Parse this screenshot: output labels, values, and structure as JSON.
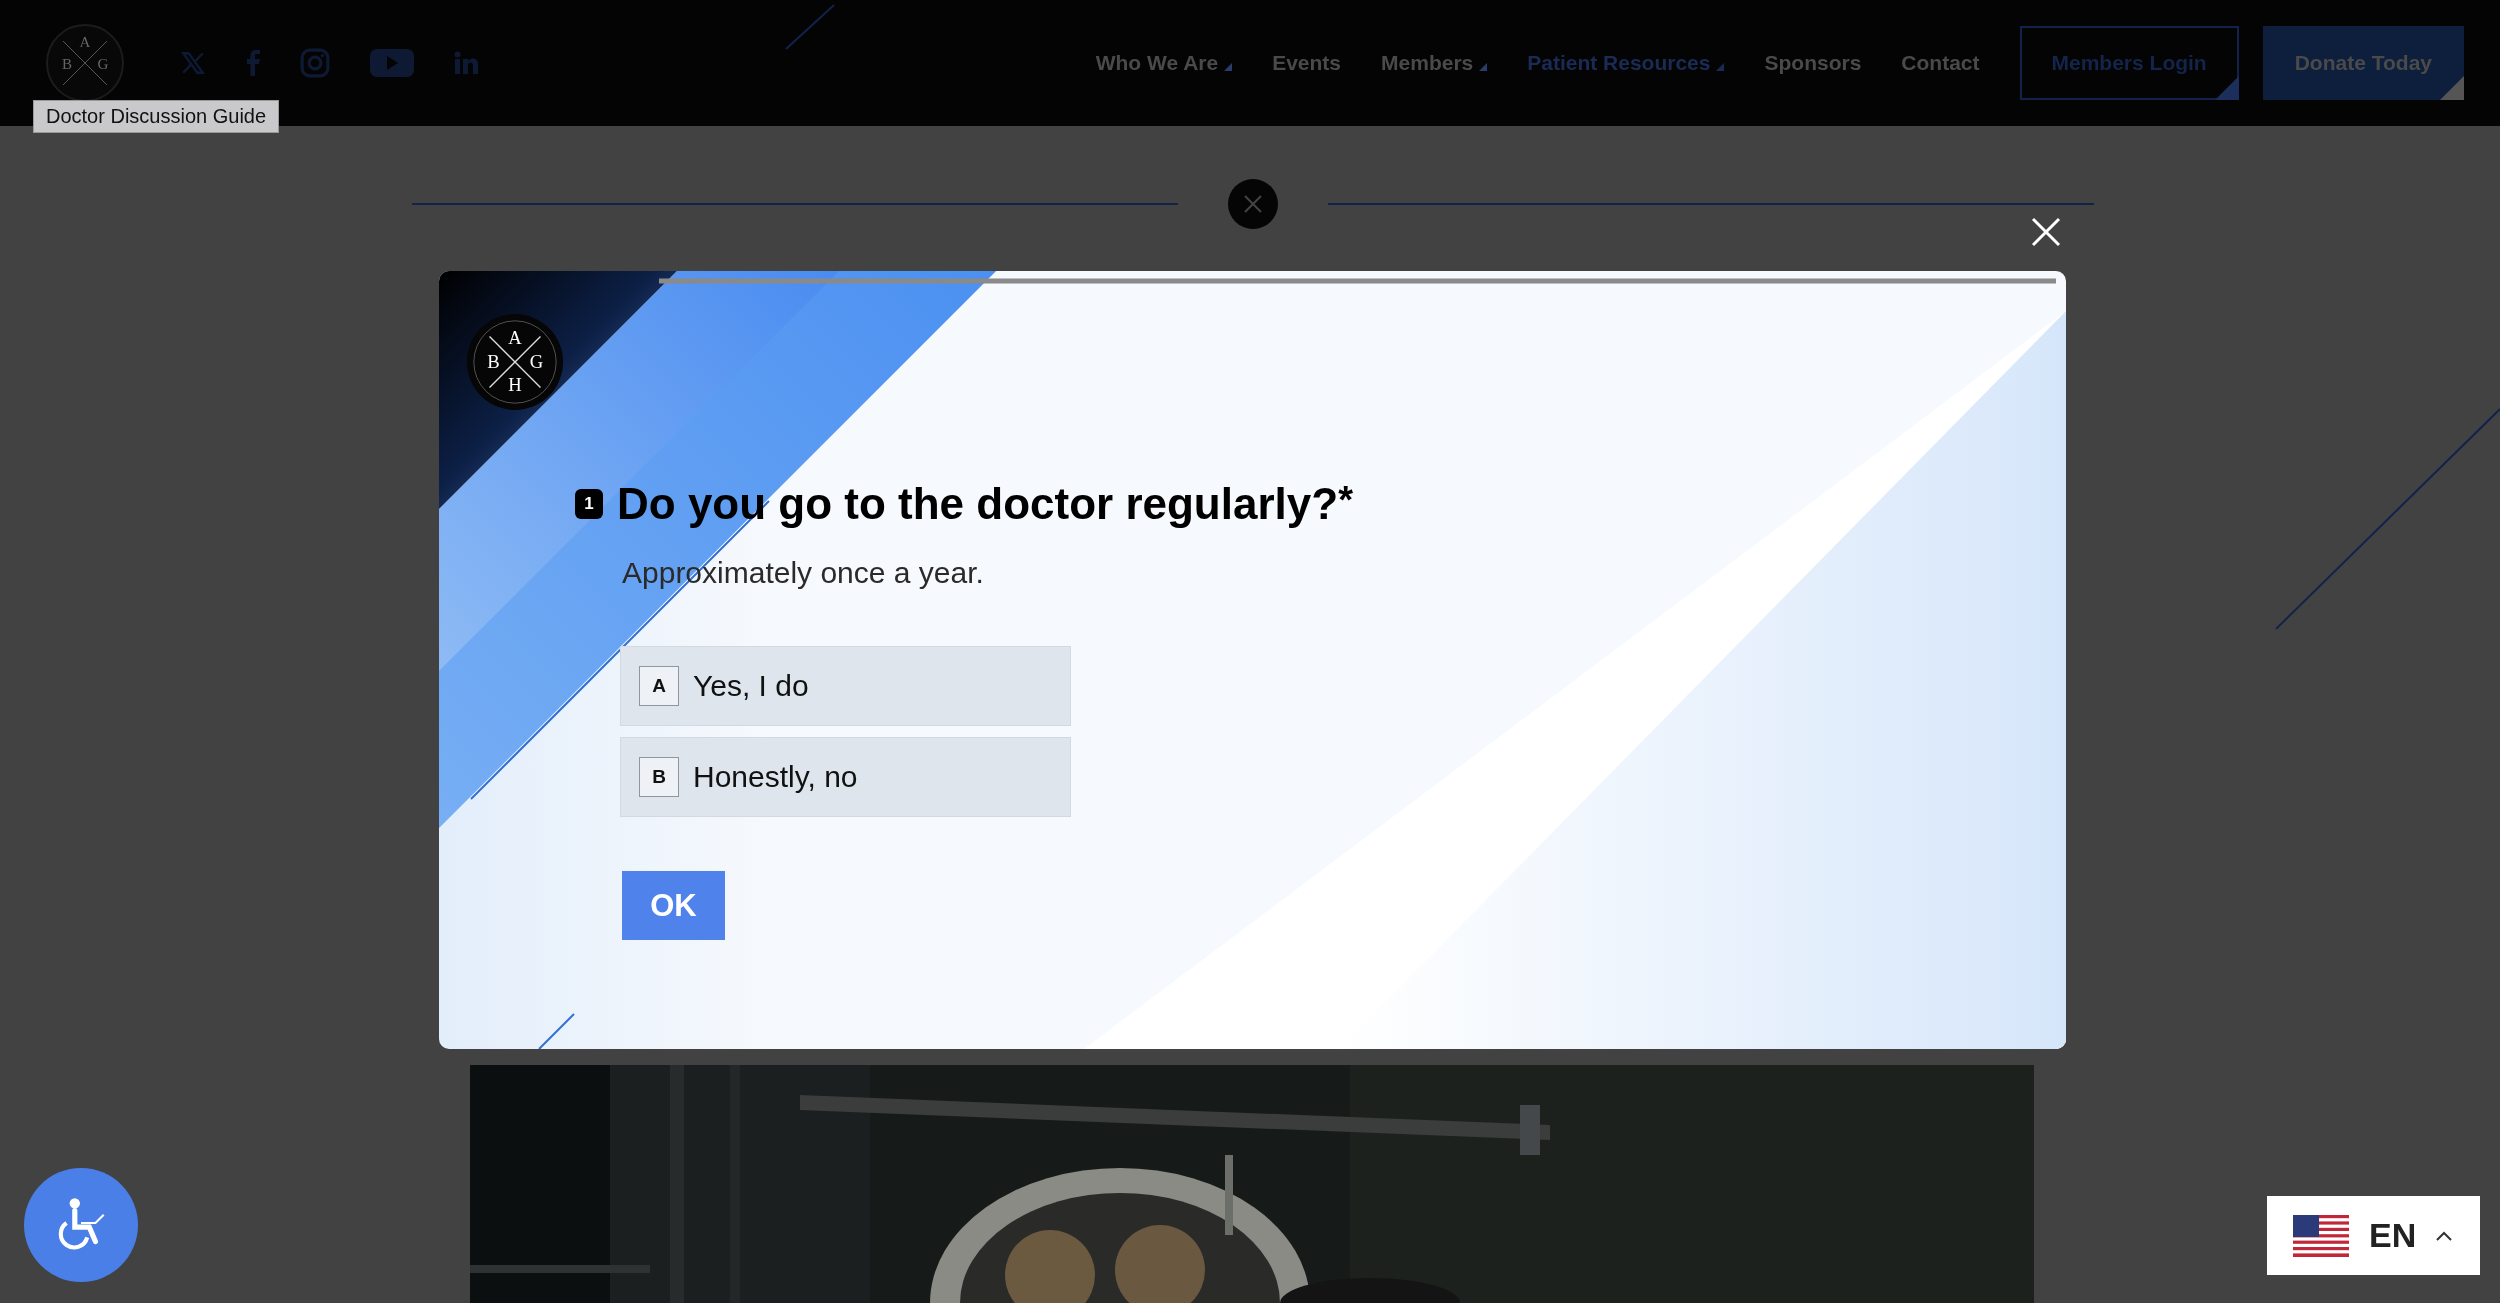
{
  "header": {
    "logo": {
      "letters": [
        "A",
        "B",
        "G"
      ]
    },
    "tooltip": "Doctor Discussion Guide",
    "nav": [
      {
        "label": "Who We Are",
        "dropdown": true,
        "selected": false
      },
      {
        "label": "Events",
        "dropdown": false,
        "selected": false
      },
      {
        "label": "Members",
        "dropdown": true,
        "selected": false
      },
      {
        "label": "Patient Resources",
        "dropdown": true,
        "selected": true
      },
      {
        "label": "Sponsors",
        "dropdown": false,
        "selected": false
      },
      {
        "label": "Contact",
        "dropdown": false,
        "selected": false
      }
    ],
    "buttons": [
      {
        "label": "Members Login",
        "kind": "outline"
      },
      {
        "label": "Donate Today",
        "kind": "filled"
      }
    ]
  },
  "quiz": {
    "logo": {
      "letters": [
        "A",
        "B",
        "G",
        "H"
      ]
    },
    "number": "1",
    "question": "Do you go to the doctor regularly?",
    "required": "*",
    "description": "Approximately once a year.",
    "options": [
      {
        "key": "A",
        "label": "Yes, I do",
        "selected": false
      },
      {
        "key": "B",
        "label": "Honestly, no",
        "selected": false
      }
    ],
    "submit": "OK"
  },
  "language": {
    "code": "EN"
  }
}
